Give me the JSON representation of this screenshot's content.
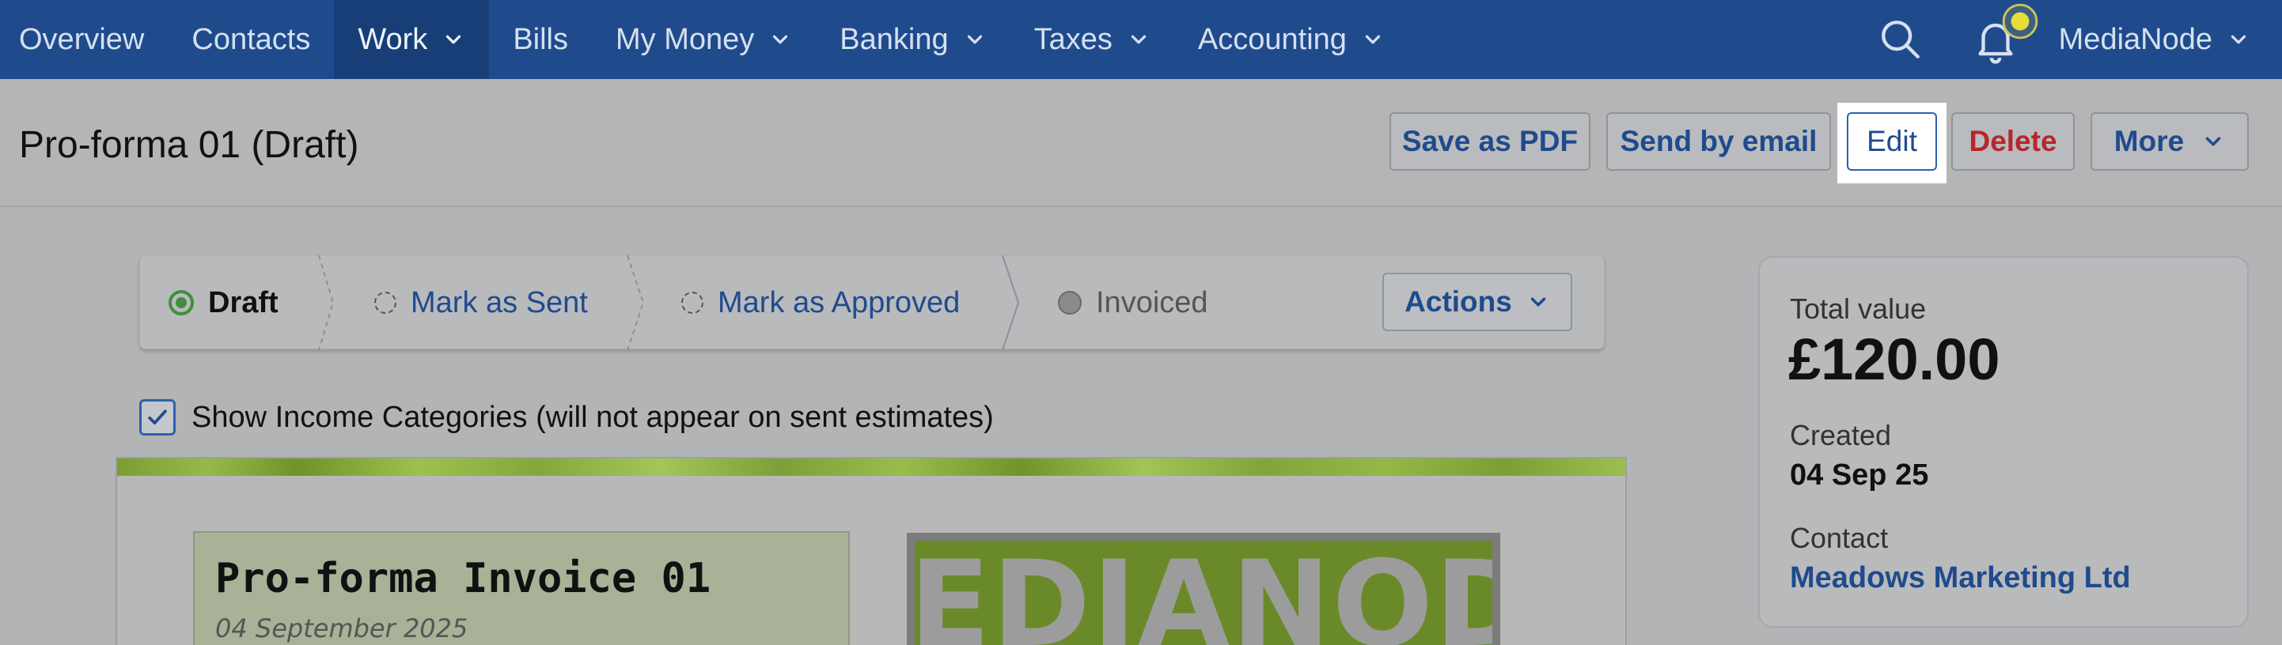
{
  "nav": {
    "items": [
      {
        "label": "Overview",
        "dropdown": false
      },
      {
        "label": "Contacts",
        "dropdown": false
      },
      {
        "label": "Work",
        "dropdown": true,
        "active": true
      },
      {
        "label": "Bills",
        "dropdown": false
      },
      {
        "label": "My Money",
        "dropdown": true
      },
      {
        "label": "Banking",
        "dropdown": true
      },
      {
        "label": "Taxes",
        "dropdown": true
      },
      {
        "label": "Accounting",
        "dropdown": true
      }
    ],
    "user": "MediaNode",
    "icons": {
      "search": "search-icon",
      "notifications": "bell-icon"
    }
  },
  "header": {
    "title": "Pro-forma 01 (Draft)",
    "buttons": {
      "save_pdf": "Save as PDF",
      "send_email": "Send by email",
      "edit": "Edit",
      "delete": "Delete",
      "more": "More"
    }
  },
  "workflow": {
    "steps": [
      {
        "label": "Draft",
        "state": "active"
      },
      {
        "label": "Mark as Sent",
        "state": "pending"
      },
      {
        "label": "Mark as Approved",
        "state": "pending"
      },
      {
        "label": "Invoiced",
        "state": "disabled"
      }
    ],
    "actions_label": "Actions"
  },
  "options": {
    "show_income_categories_label": "Show Income Categories (will not appear on sent estimates)",
    "show_income_categories_checked": true
  },
  "invoice": {
    "title": "Pro-forma Invoice 01",
    "date": "04 September 2025",
    "logo_text": "MEDIANODE"
  },
  "summary": {
    "total_label": "Total value",
    "total_value": "£120.00",
    "created_label": "Created",
    "created_value": "04 Sep 25",
    "contact_label": "Contact",
    "contact_value": "Meadows Marketing Ltd"
  },
  "colors": {
    "nav_bg": "#1f4b8d",
    "link": "#1f4b8d",
    "danger": "#b7262c",
    "status_green": "#3f8f3f",
    "logo_green": "#6a8a2a"
  }
}
